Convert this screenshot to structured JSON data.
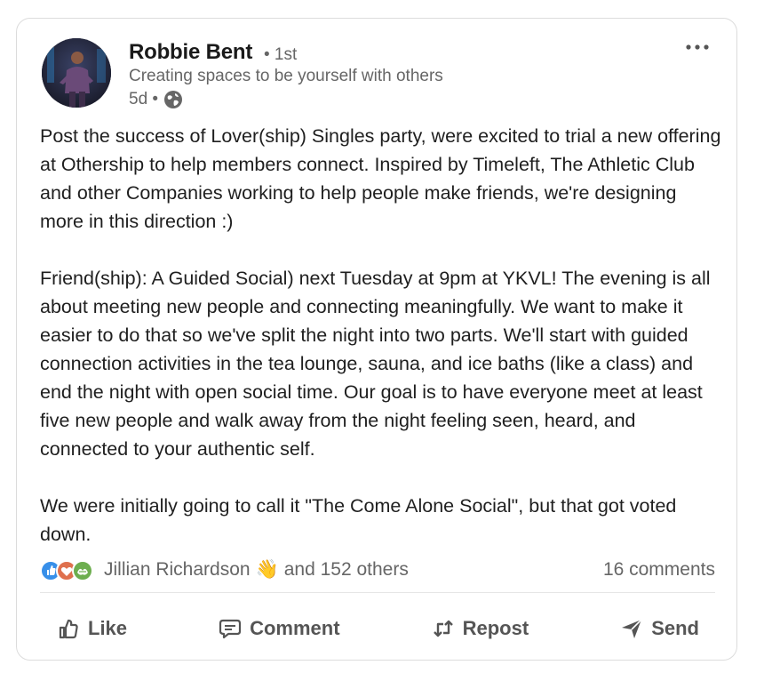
{
  "post": {
    "author": {
      "name": "Robbie Bent",
      "degree": "• 1st",
      "tagline": "Creating spaces to be yourself with others",
      "time": "5d •",
      "visibility_icon": "globe-icon"
    },
    "body": "Post the success of Lover(ship) Singles party, were excited to trial a new offering at Othership to help members connect. Inspired by Timeleft, The Athletic Club and other Companies working to help people make friends, we're designing more in this direction :)\n\nFriend(ship): A Guided Social) next Tuesday at 9pm at YKVL! The evening is all about meeting new people and connecting meaningfully. We want to make it easier to do that so we've split the night into two parts. We'll start with guided connection activities in the tea lounge, sauna, and ice baths (like a class) and end the night with open social time. Our goal is to have everyone meet at least five new people and walk away from the night feeling seen, heard, and connected to your authentic self.\n\nWe were initially going to call it \"The Come Alone Social\", but that got voted down.",
    "reactions": {
      "icons": [
        "like-icon",
        "love-icon",
        "support-icon"
      ],
      "first_name": "Jillian Richardson",
      "emoji": "👋",
      "others": "and 152 others",
      "comments": "16 comments"
    },
    "actions": {
      "like": "Like",
      "comment": "Comment",
      "repost": "Repost",
      "send": "Send"
    }
  },
  "colors": {
    "like_blue": "#378fe9",
    "love_red": "#df704d",
    "support_green": "#6dae4f"
  }
}
